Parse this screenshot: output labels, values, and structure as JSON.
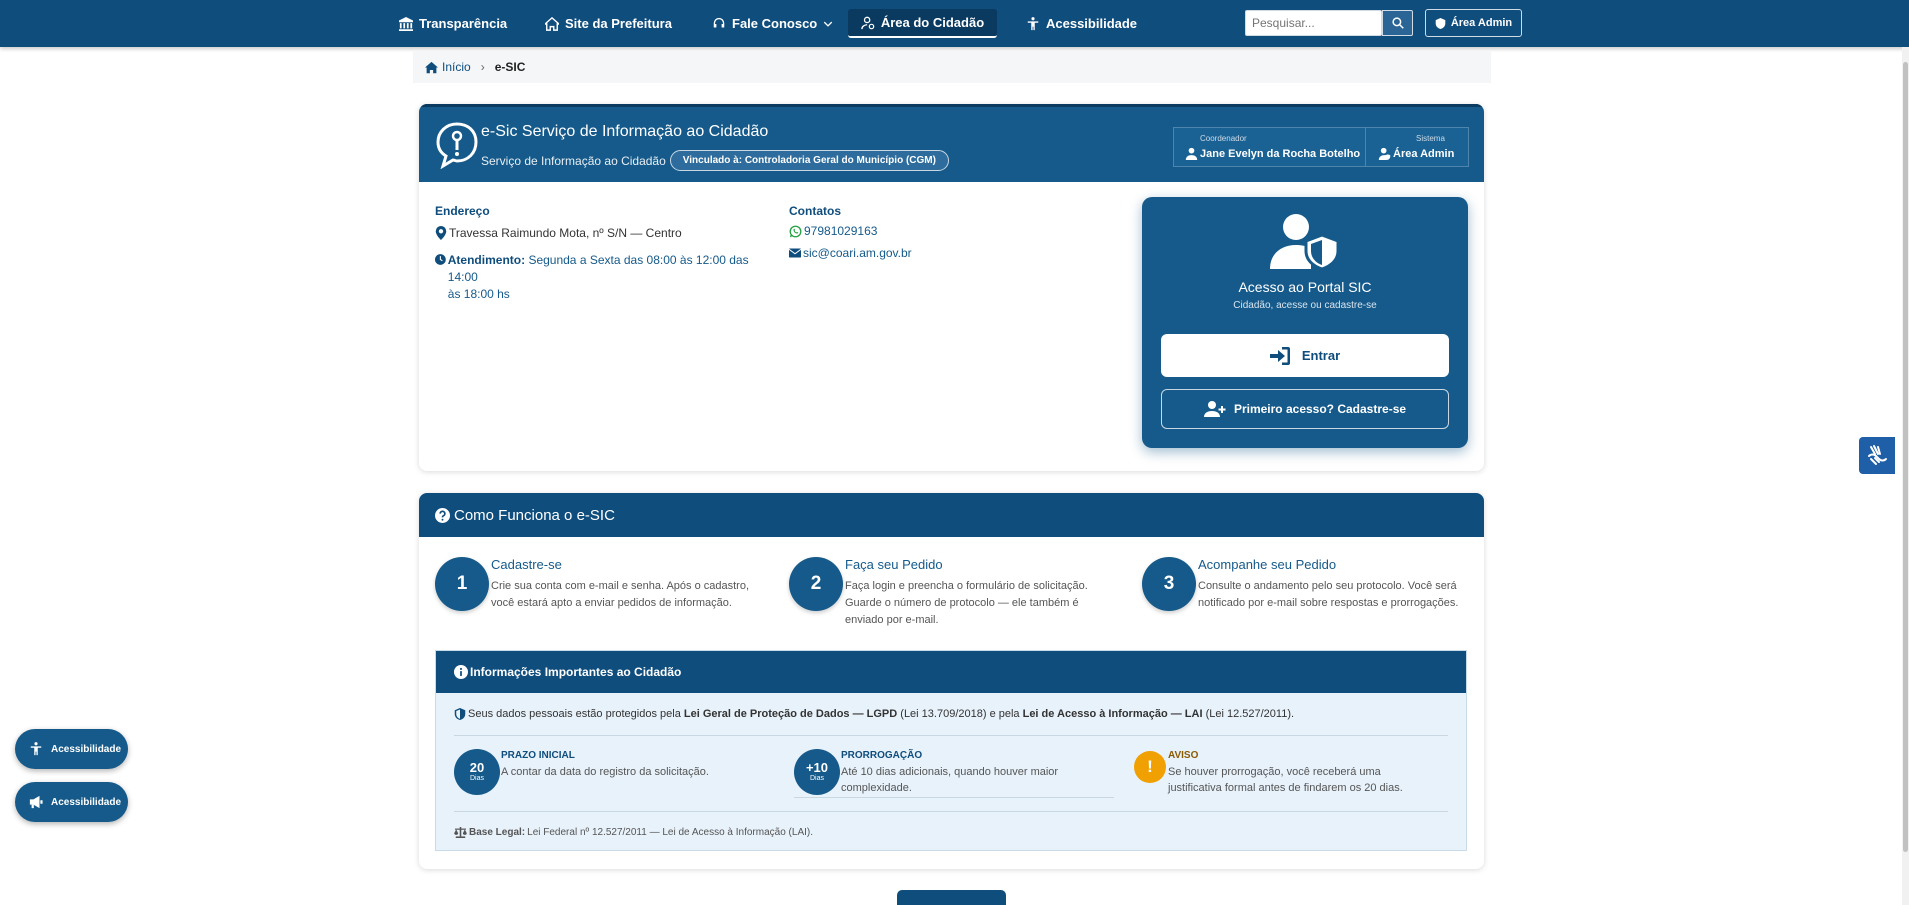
{
  "nav": {
    "items": [
      {
        "label": "Transparência",
        "icon": "institution-icon"
      },
      {
        "label": "Site da Prefeitura",
        "icon": "home-icon"
      },
      {
        "label": "Fale Conosco",
        "icon": "headset-icon"
      },
      {
        "label": "Área do Cidadão",
        "icon": "user-gear-icon"
      },
      {
        "label": "Acessibilidade",
        "icon": "accessibility-icon"
      }
    ],
    "search_placeholder": "Pesquisar...",
    "admin_label": "Área Admin"
  },
  "breadcrumb": {
    "home": "Início",
    "current": "e-SIC"
  },
  "header": {
    "title": "e-Sic Serviço de Informação ao Cidadão",
    "subtitle": "Serviço de Informação ao Cidadão",
    "pill": "Vinculado à: Controladoria Geral do Município (CGM)",
    "coord_small": "Coordenador",
    "coord_name": "Jane Evelyn da Rocha Botelho",
    "system_small": "Sistema",
    "system_name": "Área Admin"
  },
  "address": {
    "label": "Endereço",
    "street": "Travessa Raimundo Mota, nº S/N — Centro",
    "hours_label": "Atendimento:",
    "hours_line1": "Segunda a Sexta das 08:00 às 12:00 das 14:00",
    "hours_line2": "às 18:00 hs"
  },
  "contacts": {
    "label": "Contatos",
    "phone": "97981029163",
    "email": "sic@coari.am.gov.br"
  },
  "portal": {
    "title": "Acesso ao Portal SIC",
    "subtitle": "Cidadão, acesse ou cadastre-se",
    "enter_label": "Entrar",
    "register_label": "Primeiro acesso? Cadastre-se"
  },
  "how": {
    "title": "Como Funciona o e-SIC",
    "steps": [
      {
        "num": "1",
        "title": "Cadastre-se",
        "desc": "Crie sua conta com e-mail e senha. Após o cadastro, você estará apto a enviar pedidos de informação."
      },
      {
        "num": "2",
        "title": "Faça seu Pedido",
        "desc": "Faça login e preencha o formulário de solicitação. Guarde o número de protocolo — ele também é enviado por e-mail."
      },
      {
        "num": "3",
        "title": "Acompanhe seu Pedido",
        "desc": "Consulte o andamento pelo seu protocolo. Você será notificado por e-mail sobre respostas e prorrogações."
      }
    ]
  },
  "important": {
    "title": "Informações Importantes ao Cidadão",
    "lgpd_prefix": "Seus dados pessoais estão protegidos pela ",
    "lgpd_law1": "Lei Geral de Proteção de Dados — LGPD",
    "lgpd_mid": " (Lei 13.709/2018) e pela ",
    "lgpd_law2": "Lei de Acesso à Informação — LAI",
    "lgpd_suffix": " (Lei 12.527/2011).",
    "facts": [
      {
        "num": "20",
        "unit": "Dias",
        "title": "PRAZO INICIAL",
        "desc": "A contar da data do registro da solicitação."
      },
      {
        "num": "+10",
        "unit": "Dias",
        "title": "PRORROGAÇÃO",
        "desc": "Até 10 dias adicionais, quando houver maior complexidade."
      },
      {
        "num": "!",
        "unit": "",
        "title": "AVISO",
        "desc": "Se houver prorrogação, você receberá uma justificativa formal antes de findarem os 20 dias."
      }
    ],
    "base_label": "Base Legal:",
    "base_text": " Lei Federal nº 12.527/2011 — Lei de Acesso à Informação (LAI)."
  },
  "floating": {
    "a11y1": "Acessibilidade",
    "a11y2": "Acessibilidade"
  },
  "colors": {
    "primary": "#0f4d7d",
    "secondary": "#155a8a",
    "warning": "#f0a000",
    "whatsapp": "#25a244"
  }
}
